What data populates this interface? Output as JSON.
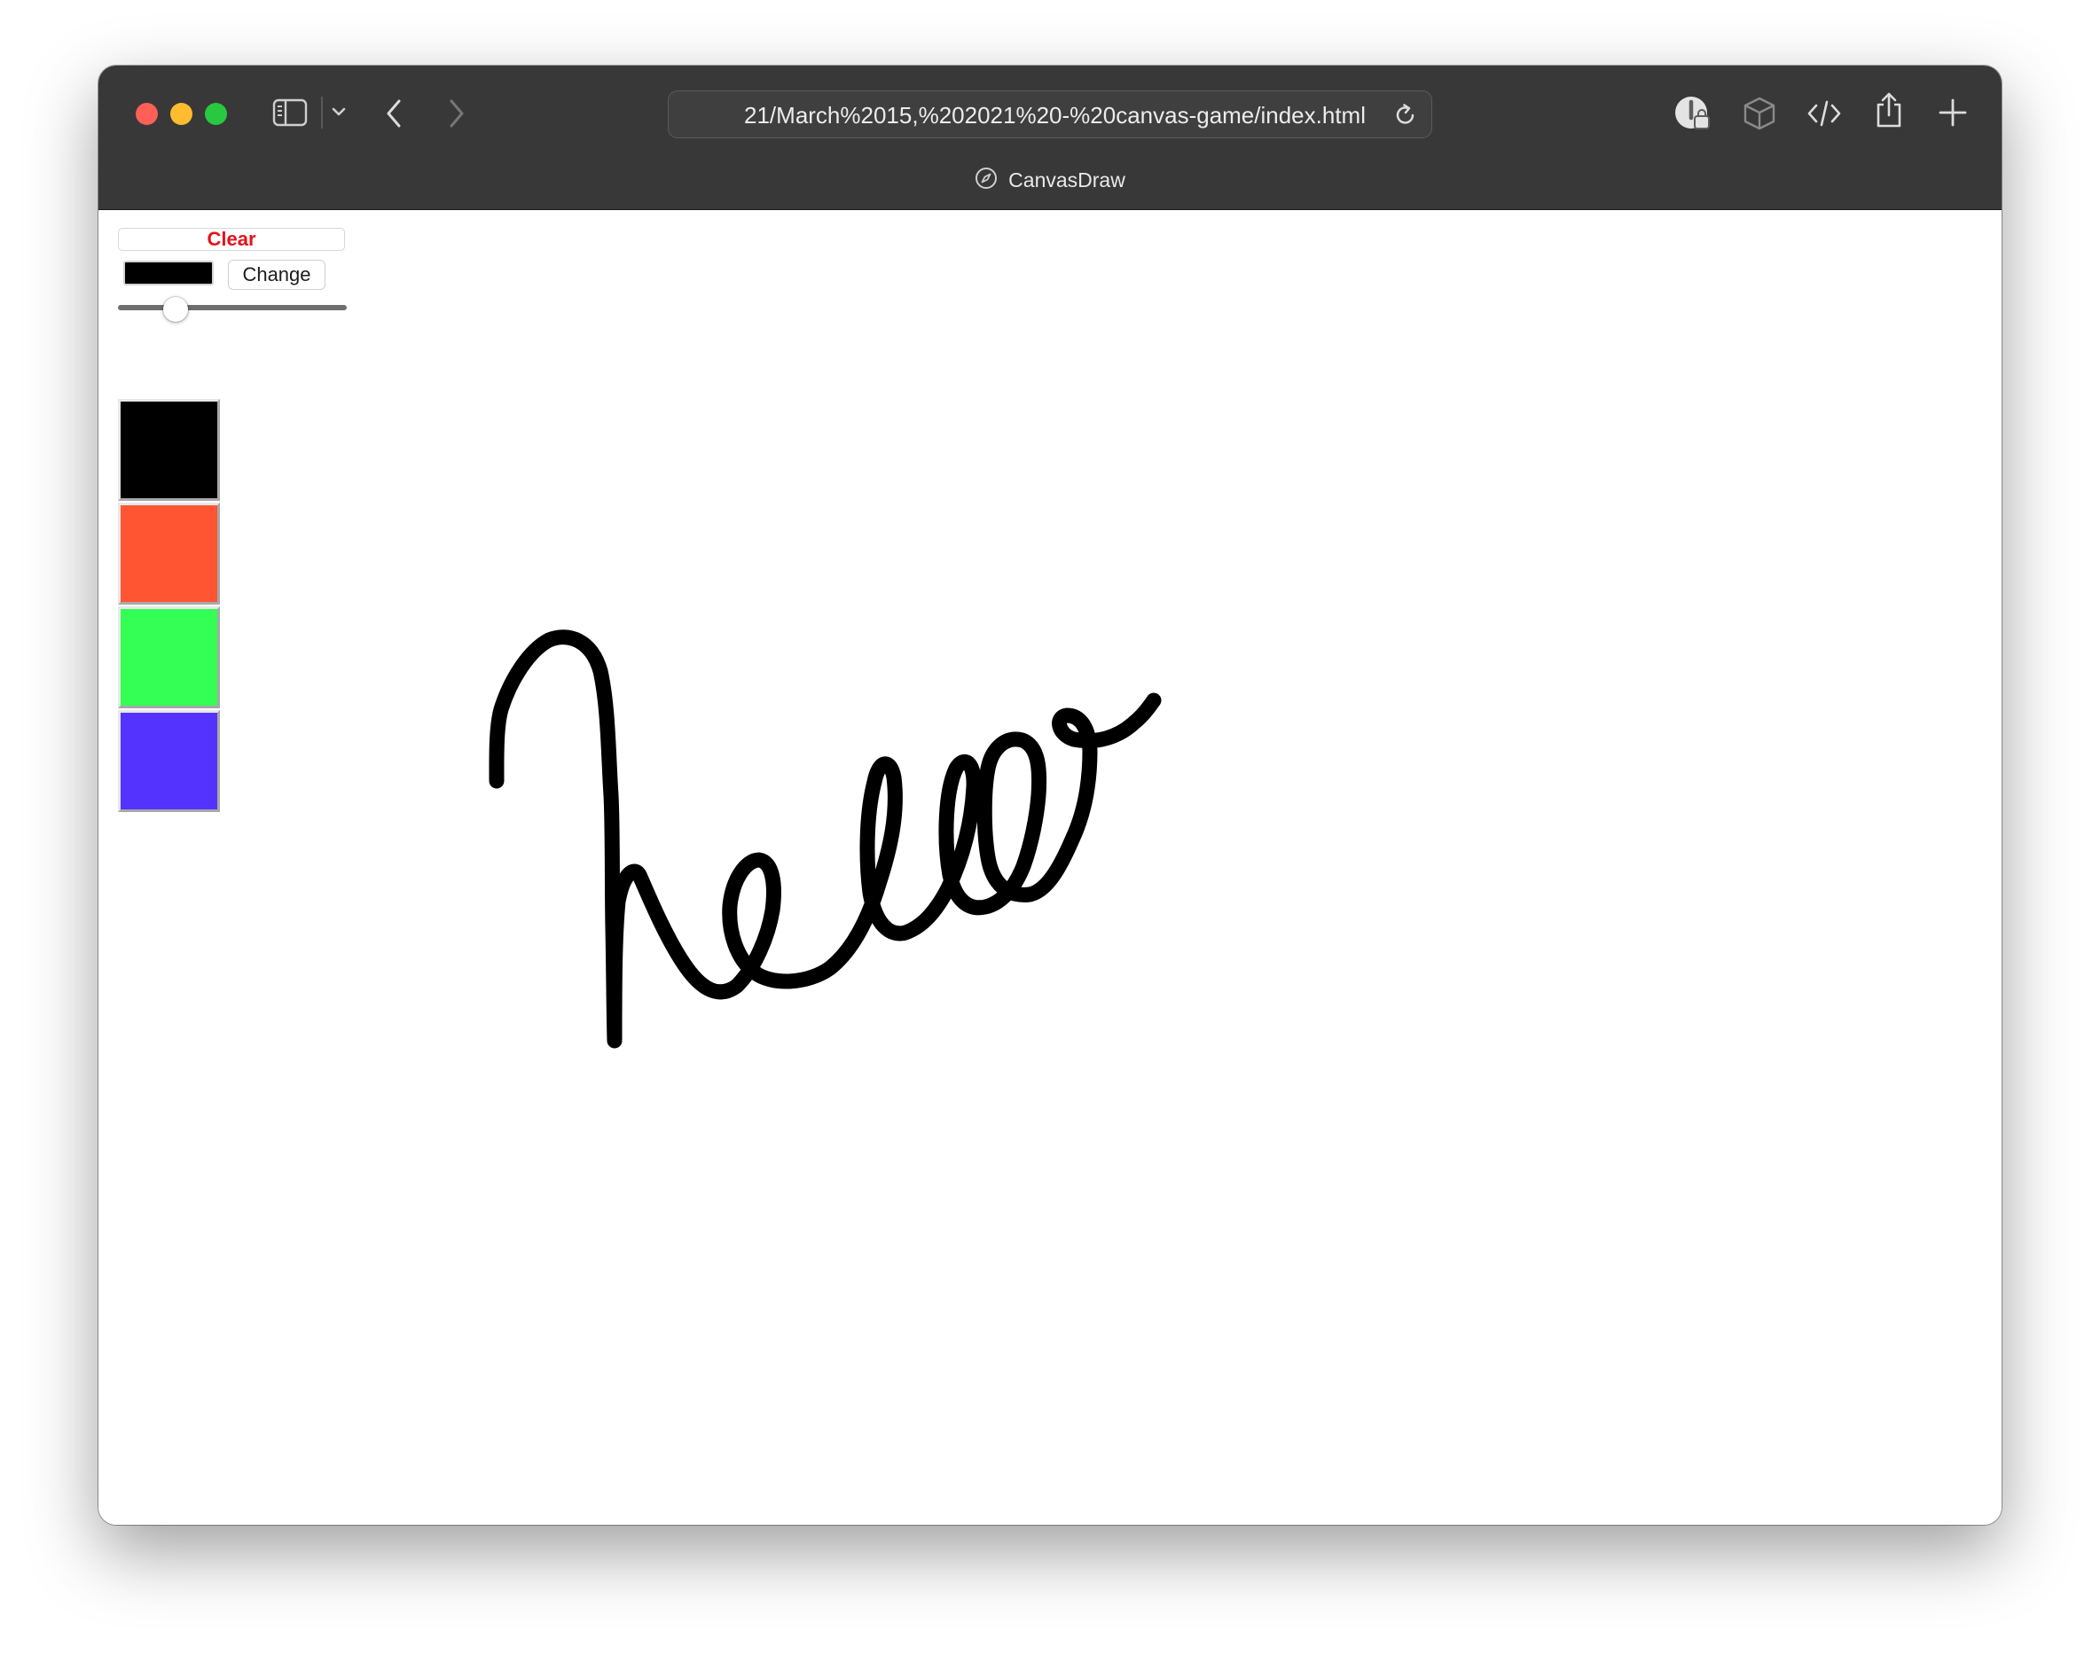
{
  "browser": {
    "url": "21/March%2015,%202021%20-%20canvas-game/index.html",
    "tab_title": "CanvasDraw"
  },
  "toolbar_icons": {
    "sidebar": "sidebar-icon",
    "sidebar_menu": "chevron-down-icon",
    "back": "chevron-left-icon",
    "forward": "chevron-right-icon",
    "reload": "reload-icon",
    "extension": "extension-icon",
    "cube": "cube-icon",
    "code": "code-icon",
    "share": "share-icon",
    "new_tab": "plus-icon",
    "tab_site": "compass-icon"
  },
  "app": {
    "clear_label": "Clear",
    "change_label": "Change",
    "current_color": "#000000",
    "brush_size_fraction": 0.22,
    "palette": [
      {
        "color": "#000000"
      },
      {
        "color": "#ff5533"
      },
      {
        "color": "#33ff55"
      },
      {
        "color": "#5533ff"
      }
    ],
    "stroke_color": "#000000"
  }
}
